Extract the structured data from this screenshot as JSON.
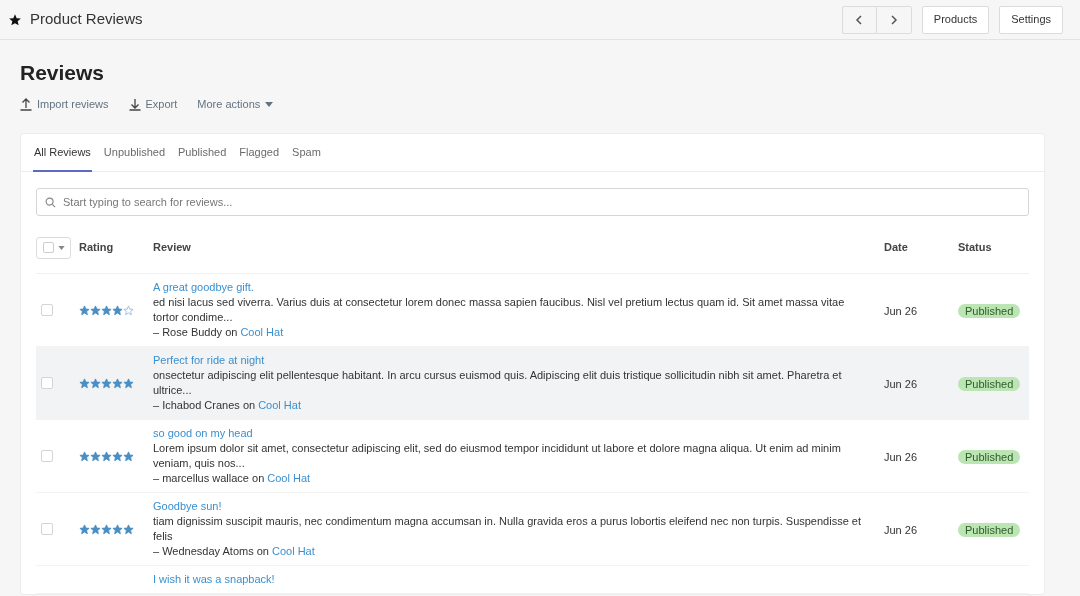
{
  "topbar": {
    "title": "Product Reviews",
    "buttons": [
      "Products",
      "Settings"
    ]
  },
  "page": {
    "title": "Reviews",
    "actions": [
      {
        "kind": "import",
        "label": "Import reviews"
      },
      {
        "kind": "export",
        "label": "Export"
      },
      {
        "kind": "menu",
        "label": "More actions"
      }
    ]
  },
  "tabs": [
    {
      "label": "All Reviews",
      "selected": true
    },
    {
      "label": "Unpublished",
      "selected": false
    },
    {
      "label": "Published",
      "selected": false
    },
    {
      "label": "Flagged",
      "selected": false
    },
    {
      "label": "Spam",
      "selected": false
    }
  ],
  "search": {
    "placeholder": "Start typing to search for reviews..."
  },
  "table": {
    "select_all": {
      "checked": false
    },
    "columns": [
      "Rating",
      "Review",
      "Date",
      "Status"
    ],
    "rows": [
      {
        "checked": false,
        "highlighted": false,
        "stars": 4,
        "title": "A great goodbye gift.",
        "body": "ed nisi lacus sed viverra. Varius duis at consectetur lorem donec massa sapien faucibus. Nisl vel pretium lectus quam id. Sit amet massa vitae tortor condime...",
        "author": "– Rose Buddy on",
        "product": "Cool Hat",
        "date": "Jun 26",
        "status": "Published"
      },
      {
        "checked": false,
        "highlighted": true,
        "stars": 5,
        "title": "Perfect for ride at night",
        "body": "onsectetur adipiscing elit pellentesque habitant. In arcu cursus euismod quis. Adipiscing elit duis tristique sollicitudin nibh sit amet. Pharetra et ultrice...",
        "author": "– Ichabod Cranes on",
        "product": "Cool Hat",
        "date": "Jun 26",
        "status": "Published"
      },
      {
        "checked": false,
        "highlighted": false,
        "stars": 5,
        "title": "so good on my head",
        "body": "Lorem ipsum dolor sit amet, consectetur adipiscing elit, sed do eiusmod tempor incididunt ut labore et dolore magna aliqua. Ut enim ad minim veniam, quis nos...",
        "author": "– marcellus wallace on",
        "product": "Cool Hat",
        "date": "Jun 26",
        "status": "Published"
      },
      {
        "checked": false,
        "highlighted": false,
        "stars": 5,
        "title": "Goodbye sun!",
        "body": "tiam dignissim suscipit mauris, nec condimentum magna accumsan in. Nulla gravida eros a purus lobortis eleifend nec non turpis. Suspendisse et felis",
        "author": "– Wednesday Atoms on",
        "product": "Cool Hat",
        "date": "Jun 26",
        "status": "Published"
      },
      {
        "title": "I wish it was a snapback!"
      }
    ]
  }
}
